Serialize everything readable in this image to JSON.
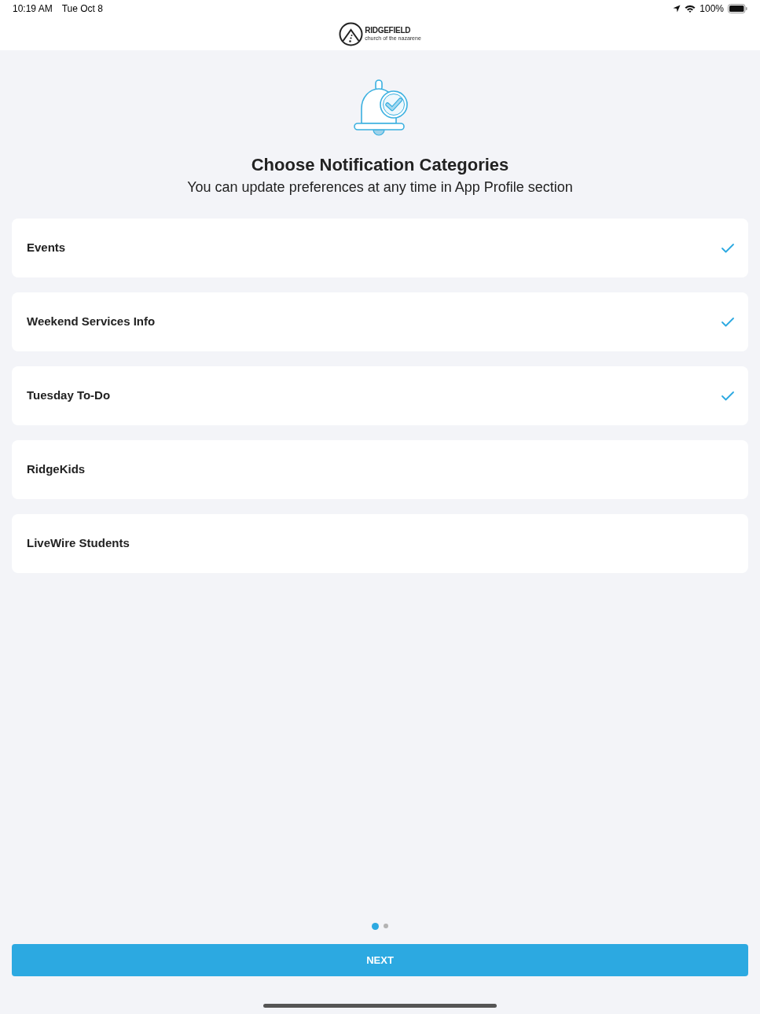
{
  "status_bar": {
    "time": "10:19 AM",
    "date": "Tue Oct 8",
    "battery": "100%"
  },
  "header": {
    "logo_name": "RIDGEFIELD",
    "logo_subtitle": "church of the nazarene"
  },
  "intro": {
    "title": "Choose Notification Categories",
    "subtitle": "You can update preferences at any time in App Profile section"
  },
  "categories": [
    {
      "label": "Events",
      "selected": true
    },
    {
      "label": "Weekend Services Info",
      "selected": true
    },
    {
      "label": "Tuesday To-Do",
      "selected": true
    },
    {
      "label": "RidgeKids",
      "selected": false
    },
    {
      "label": "LiveWire Students",
      "selected": false
    }
  ],
  "pager": [
    {
      "selected": true
    },
    {
      "selected": false
    }
  ],
  "next_button": {
    "label": "NEXT"
  }
}
